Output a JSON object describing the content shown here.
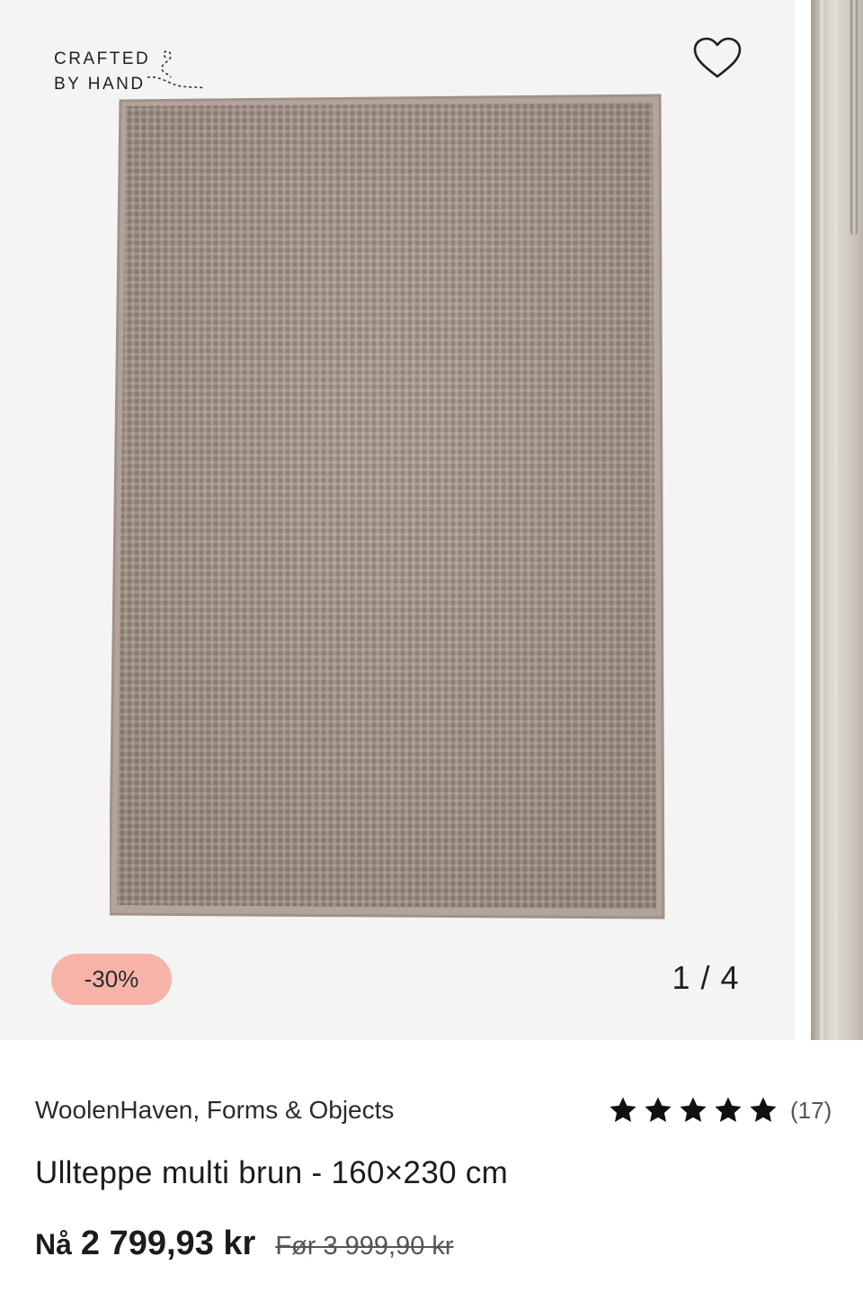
{
  "badge": {
    "line1": "CRAFTED",
    "line2": "BY HAND"
  },
  "gallery": {
    "counter": "1 / 4",
    "discount": "-30%"
  },
  "product": {
    "brand": "WoolenHaven, Forms & Objects",
    "title": "Ullteppe multi brun - 160×230 cm",
    "rating": {
      "stars": 5,
      "max": 5,
      "count": "(17)"
    },
    "price": {
      "now_label": "Nå",
      "now": "2 799,93 kr",
      "before": "Før 3 999,90 kr"
    }
  },
  "icons": {
    "favorite": "heart-outline-icon",
    "rating": "star-icon",
    "badge": "thread-needle-icon"
  },
  "colors": {
    "discount_pill": "#f8b3a8",
    "rug": "#9e8e84",
    "gallery_bg": "#f4f4f4"
  }
}
